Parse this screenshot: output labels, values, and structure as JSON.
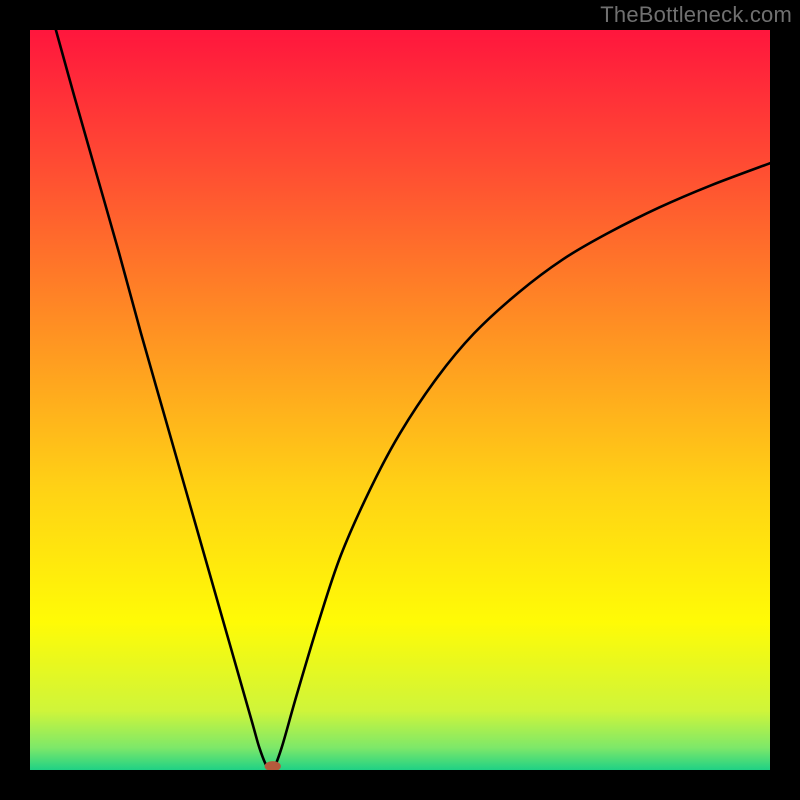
{
  "watermark": "TheBottleneck.com",
  "chart_data": {
    "type": "line",
    "title": "",
    "xlabel": "",
    "ylabel": "",
    "xlim": [
      0,
      100
    ],
    "ylim": [
      0,
      100
    ],
    "grid": false,
    "legend": false,
    "background_gradient": {
      "stops": [
        {
          "offset": 0.0,
          "color": "#ff163d"
        },
        {
          "offset": 0.18,
          "color": "#ff4b33"
        },
        {
          "offset": 0.4,
          "color": "#ff8f23"
        },
        {
          "offset": 0.62,
          "color": "#ffd215"
        },
        {
          "offset": 0.8,
          "color": "#fffb06"
        },
        {
          "offset": 0.92,
          "color": "#cff53a"
        },
        {
          "offset": 0.97,
          "color": "#7de869"
        },
        {
          "offset": 1.0,
          "color": "#1fd185"
        }
      ]
    },
    "series": [
      {
        "name": "curve",
        "color": "#000000",
        "x": [
          3.5,
          6,
          9,
          12,
          15,
          18,
          21,
          24,
          27,
          30,
          31,
          32,
          32.8,
          34,
          36,
          39,
          42,
          46,
          50,
          55,
          60,
          66,
          72,
          78,
          85,
          92,
          100
        ],
        "y": [
          100,
          91,
          80.5,
          70,
          59,
          48.5,
          38,
          27.5,
          17,
          6.5,
          3,
          0.5,
          0,
          3,
          10,
          20,
          29,
          38,
          45.5,
          53,
          59,
          64.5,
          69,
          72.5,
          76,
          79,
          82
        ]
      }
    ],
    "marker": {
      "name": "min-point",
      "x": 32.8,
      "y": 0.5,
      "rx": 1.1,
      "ry": 0.7,
      "fill": "#b45a3c"
    }
  }
}
